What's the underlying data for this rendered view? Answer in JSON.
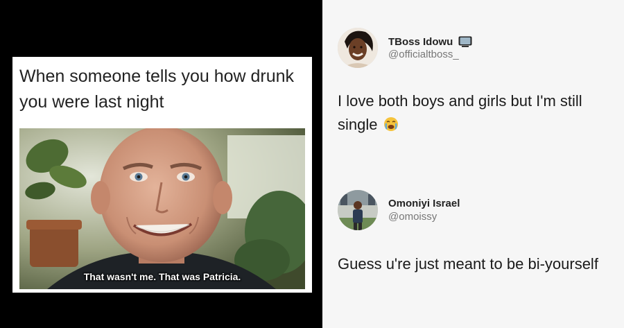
{
  "meme": {
    "caption": "When someone tells you how drunk you were last night",
    "subtitle": "That wasn't me. That was Patricia."
  },
  "tweets": [
    {
      "name": "TBoss Idowu",
      "handle": "@officialtboss_",
      "badge_icon": "tv-icon",
      "text": "I love both boys and girls but I'm still single",
      "emoji_icon": "crying-face-icon"
    },
    {
      "name": "Omoniyi Israel",
      "handle": "@omoissy",
      "text": "Guess u're just meant to be bi-yourself"
    }
  ]
}
